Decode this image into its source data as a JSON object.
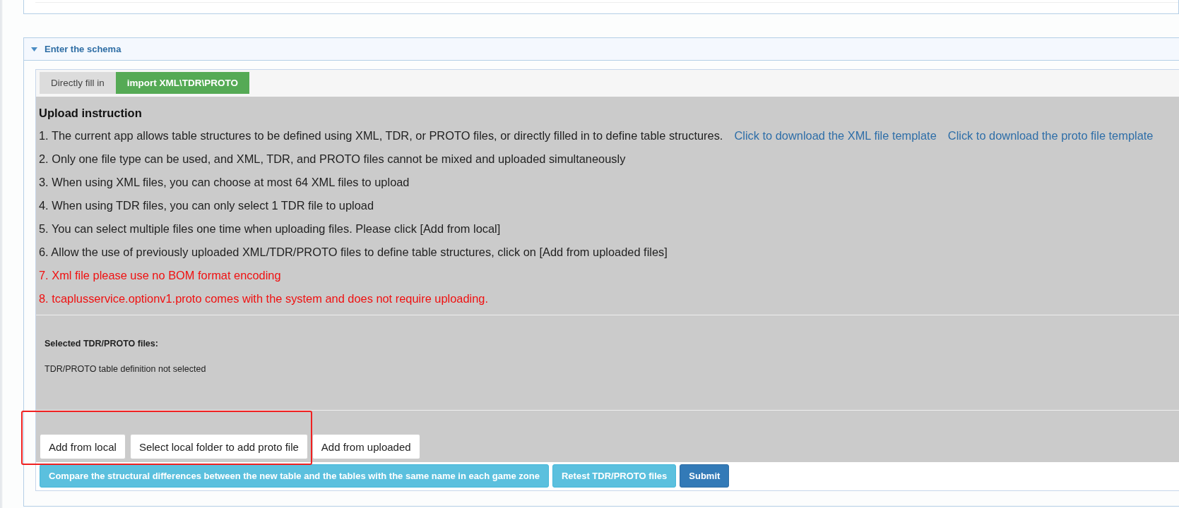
{
  "panel": {
    "title": "Enter the schema",
    "expanded": true
  },
  "tabs": [
    {
      "label": "Directly fill in",
      "selected": false
    },
    {
      "label": "import XML\\TDR\\PROTO",
      "selected": true
    }
  ],
  "instructions": {
    "heading": "Upload instruction",
    "items": [
      {
        "text": "1. The current app allows table structures to be defined using XML, TDR, or PROTO files, or directly filled in to define table structures.",
        "warning": false,
        "links": [
          "Click to download the XML file template",
          "Click to download the proto file template"
        ]
      },
      {
        "text": "2. Only one file type can be used, and XML, TDR, and PROTO files cannot be mixed and uploaded simultaneously",
        "warning": false
      },
      {
        "text": "3. When using XML files, you can choose at most 64 XML files to upload",
        "warning": false
      },
      {
        "text": "4. When using TDR files, you can only select 1 TDR file to upload",
        "warning": false
      },
      {
        "text": "5. You can select multiple files one time when uploading files. Please click [Add from local]",
        "warning": false
      },
      {
        "text": "6. Allow the use of previously uploaded XML/TDR/PROTO files to define table structures, click on [Add from uploaded files]",
        "warning": false
      },
      {
        "text": "7. Xml file please use no BOM format encoding",
        "warning": true
      },
      {
        "text": "8. tcaplusservice.optionv1.proto comes with the system and does not require uploading.",
        "warning": true
      }
    ]
  },
  "selected_files": {
    "label": "Selected TDR/PROTO files:",
    "status": "TDR/PROTO table definition not selected"
  },
  "upload_buttons": [
    {
      "label": "Add from local",
      "highlighted": true
    },
    {
      "label": "Select local folder to add proto file",
      "highlighted": true
    },
    {
      "label": "Add from uploaded",
      "highlighted": false
    }
  ],
  "action_buttons": [
    {
      "label": "Compare the structural differences between the new table and the tables with the same name in each game zone",
      "kind": "info"
    },
    {
      "label": "Retest TDR/PROTO files",
      "kind": "info"
    },
    {
      "label": "Submit",
      "kind": "primary"
    }
  ]
}
